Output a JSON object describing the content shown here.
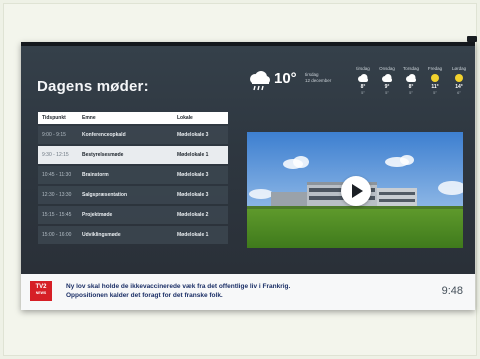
{
  "meetings": {
    "title": "Dagens møder:",
    "headers": {
      "time": "Tidspunkt",
      "subject": "Emne",
      "room": "Lokale"
    },
    "rows": [
      {
        "time": "9:00 - 9:15",
        "subject": "Konferenceopkald",
        "room": "Mødelokale 3",
        "active": false
      },
      {
        "time": "9:30 - 12:15",
        "subject": "Bestyrelsesmøde",
        "room": "Mødelokale 1",
        "active": true
      },
      {
        "time": "10:45 - 11:30",
        "subject": "Brainstorm",
        "room": "Mødelokale 3",
        "active": false
      },
      {
        "time": "12:30 - 13:30",
        "subject": "Salgspræsentation",
        "room": "Mødelokale 3",
        "active": false
      },
      {
        "time": "15:15 - 15:45",
        "subject": "Projektmøde",
        "room": "Mødelokale 2",
        "active": false
      },
      {
        "time": "15:00 - 16:00",
        "subject": "Udviklingsmøde",
        "room": "Mødelokale 1",
        "active": false
      }
    ]
  },
  "weather": {
    "current": {
      "temp": "10°",
      "day": "tirsdag",
      "date": "12 december",
      "icon": "rain-cloud-icon"
    },
    "forecast": [
      {
        "day": "tirsdag",
        "hi": "8°",
        "lo": "5°",
        "icon": "cloud-icon"
      },
      {
        "day": "Onsdag",
        "hi": "9°",
        "lo": "5°",
        "icon": "cloud-icon"
      },
      {
        "day": "Torsdag",
        "hi": "8°",
        "lo": "5°",
        "icon": "cloud-icon"
      },
      {
        "day": "Fredag",
        "hi": "11°",
        "lo": "5°",
        "icon": "sun-icon"
      },
      {
        "day": "Lørdag",
        "hi": "14°",
        "lo": "6°",
        "icon": "sun-icon"
      }
    ]
  },
  "video": {
    "icon": "play-icon"
  },
  "ticker": {
    "logo_top": "TV2",
    "logo_bottom": "NEWS",
    "headline_line1": "Ny lov skal holde de ikkevaccinerede væk fra det offentlige liv i Frankrig.",
    "headline_line2": "Oppositionen kalder det foragt for det franske folk.",
    "clock": "9:48"
  },
  "colors": {
    "accent_red": "#d61f26",
    "ticker_text": "#1b2f66",
    "screen_bg": "#2c333b"
  }
}
